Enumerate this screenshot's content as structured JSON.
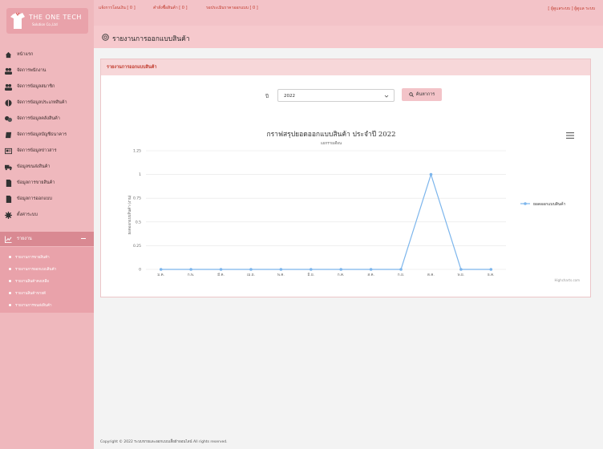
{
  "logo": {
    "title": "THE ONE TECH",
    "subtitle": "Solution Co.,Ltd"
  },
  "sidebar": {
    "items": [
      {
        "label": "หน้าแรก",
        "icon": "home-icon"
      },
      {
        "label": "จัดการพนักงาน",
        "icon": "users-icon"
      },
      {
        "label": "จัดการข้อมูลสมาชิก",
        "icon": "members-icon"
      },
      {
        "label": "จัดการข้อมูลประเภทสินค้า",
        "icon": "tag-icon"
      },
      {
        "label": "จัดการข้อมูลคลังสินค้า",
        "icon": "warehouse-icon"
      },
      {
        "label": "จัดการข้อมูลบัญชีธนาคาร",
        "icon": "bank-icon"
      },
      {
        "label": "จัดการข้อมูลข่าวสาร",
        "icon": "news-icon"
      },
      {
        "label": "ข้อมูลขนส่งสินค้า",
        "icon": "truck-icon"
      },
      {
        "label": "ข้อมูลการขายสินค้า",
        "icon": "sales-doc-icon"
      },
      {
        "label": "ข้อมูลการออกแบบ",
        "icon": "design-doc-icon"
      },
      {
        "label": "ตั้งค่าระบบ",
        "icon": "gear-icon"
      }
    ],
    "report": {
      "label": "รายงาน",
      "icon": "chart-icon"
    },
    "submenu": [
      "รายงานการขายสินค้า",
      "รายงานการออกแบบสินค้า",
      "รายงานสินค้าคงเหลือ",
      "รายงานสินค้าขายดี",
      "รายงานการขนส่งสินค้า"
    ]
  },
  "topbar": {
    "links": [
      "แจ้งการโอนเงิน [ 0 ]",
      "คำสั่งซื้อสินค้า [ 0 ]",
      "รอประเมินราคาออกแบบ [ 0 ]"
    ],
    "user": "[ ผู้ดูแลระบบ ] ผู้ดูแล ระบบ"
  },
  "page": {
    "title": "รายงานการออกแบบสินค้า"
  },
  "card": {
    "title": "รายงานการออกแบบสินค้า"
  },
  "filter": {
    "year_label": "ปี",
    "year_value": "2022",
    "search_label": "ค้นหาการ"
  },
  "colors": {
    "accent": "#c0392b",
    "sidebar_bg": "#efb8bd",
    "series": "#7cb5ec"
  },
  "chart_data": {
    "type": "line",
    "title": "กราฟสรุปยอดออกแบบสินค้า ประจำปี 2022",
    "subtitle": "แยกรายเดือน",
    "ylabel": "ยอดออกแบบสินค้า (งาน)",
    "xlabel": "",
    "ylim": [
      0,
      1.25
    ],
    "yticks": [
      "0",
      "0.25",
      "0.5",
      "0.75",
      "1",
      "1.25"
    ],
    "categories": [
      "ม.ค.",
      "ก.พ.",
      "มี.ค.",
      "เม.ย.",
      "พ.ค.",
      "มิ.ย.",
      "ก.ค.",
      "ส.ค.",
      "ก.ย.",
      "ต.ค.",
      "พ.ย.",
      "ธ.ค."
    ],
    "series": [
      {
        "name": "ยอดออกแบบสินค้า",
        "values": [
          0,
          0,
          0,
          0,
          0,
          0,
          0,
          0,
          0,
          1,
          0,
          0
        ]
      }
    ],
    "legend": "right",
    "grid": true,
    "credits": "Highcharts.com"
  },
  "footer": {
    "text": "Copyright © 2022 ระบบขายและออกแบบเสื้อผ้าออนไลน์ All rights reserved."
  }
}
